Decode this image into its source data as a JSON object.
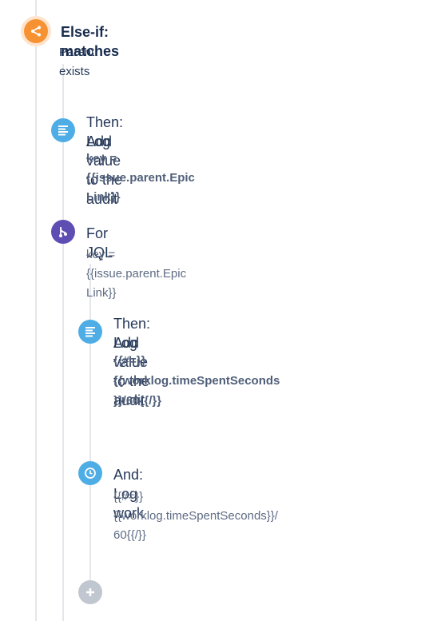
{
  "else_if": {
    "title": "Else-if: matches",
    "subtitle": "Parent exists",
    "icon": "branch-icon",
    "color": "#f79232"
  },
  "steps": [
    {
      "title_line1": "Then: Add value to the audit",
      "title_line2": "Log",
      "detail_lines": [
        "key = {{issue.parent.Epic Link}}"
      ],
      "icon": "log-lines-icon",
      "color": "#4fade6"
    },
    {
      "title_line1": "For JQL",
      "detail_lines": [
        "key = {{issue.parent.Epic Link}}"
      ],
      "icon": "branch-fork-icon",
      "color": "#5e4db2"
    },
    {
      "title_line1": "Then: Add value to the audit",
      "title_line2": "Log",
      "detail_lines": [
        "{{#=}}",
        "{{worklog.timeSpentSeconds",
        "}}/60{{/}}"
      ],
      "icon": "log-lines-icon",
      "color": "#4fade6"
    },
    {
      "title_line1": "And: Log work",
      "detail_lines": [
        "{{#=}}",
        "{{worklog.timeSpentSeconds}}/",
        "60{{/}}"
      ],
      "icon": "clock-icon",
      "color": "#4fade6"
    }
  ],
  "add_button": {
    "icon": "plus-icon",
    "color": "#c1c7d0"
  }
}
